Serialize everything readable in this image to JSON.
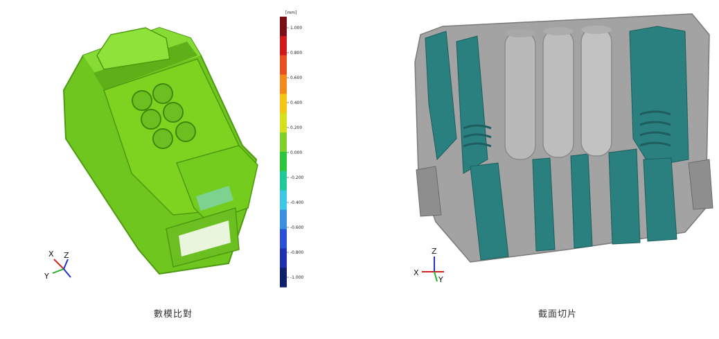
{
  "left": {
    "caption": "數模比對",
    "scale": {
      "unit": "[mm]",
      "ticks": [
        "1.000",
        "0.800",
        "0.600",
        "0.400",
        "0.200",
        "0.000",
        "-0.200",
        "-0.400",
        "-0.600",
        "-0.800",
        "-1.000"
      ],
      "colors": [
        "#7a0f17",
        "#d01a1a",
        "#e8501e",
        "#f28a1e",
        "#f5c518",
        "#d8e01c",
        "#7fd12a",
        "#2ec73b",
        "#22c89a",
        "#3cc8e6",
        "#3a8fe0",
        "#2b50d8",
        "#1e2fb0",
        "#101f6a"
      ]
    },
    "axes": {
      "x": "X",
      "y": "Y",
      "z": "Z"
    },
    "model_color": "#7ed321"
  },
  "right": {
    "caption": "截面切片",
    "axes": {
      "x": "X",
      "y": "Y",
      "z": "Z"
    },
    "body_color": "#9a9a9a",
    "section_color": "#2a7f7f"
  }
}
